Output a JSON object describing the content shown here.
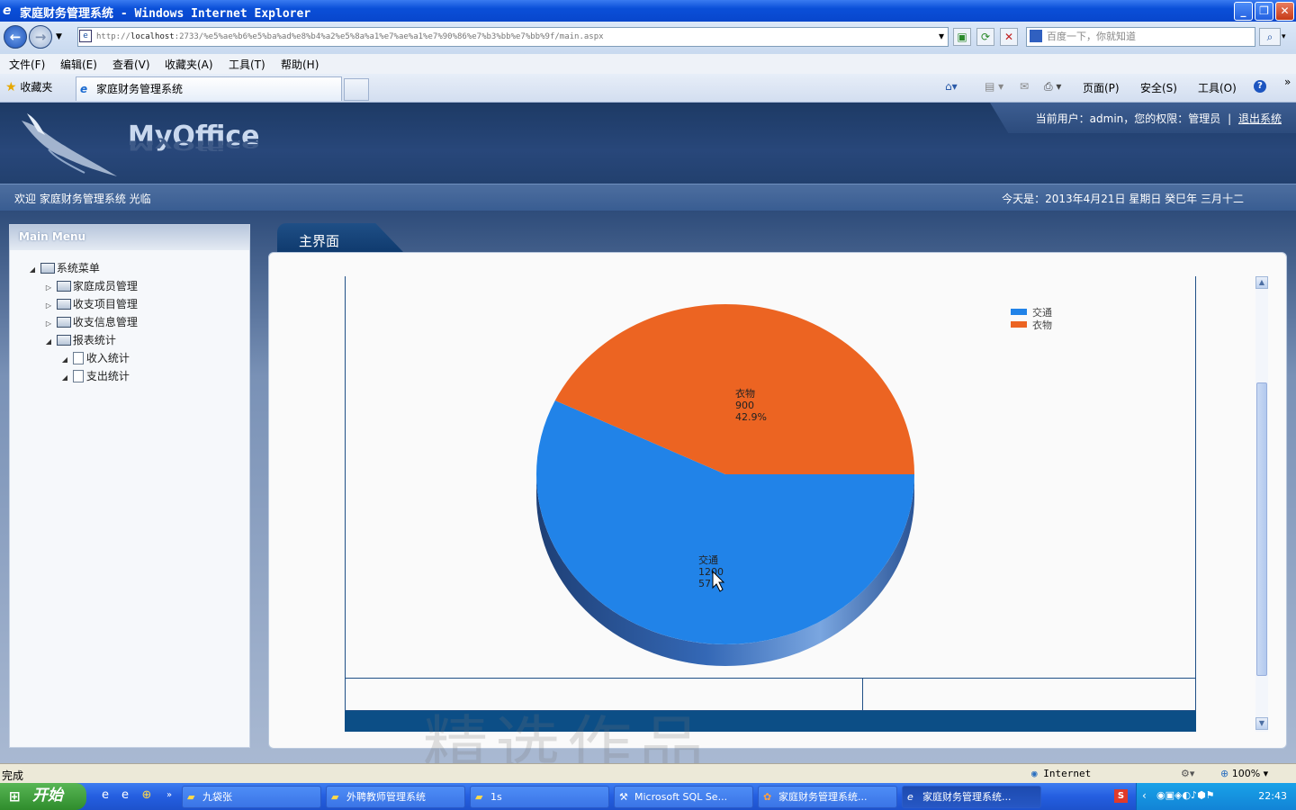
{
  "window": {
    "title": "家庭财务管理系统 - Windows Internet Explorer",
    "buttons": {
      "minimize": "_",
      "restore": "❐",
      "close": "✕"
    }
  },
  "addressbar": {
    "url_prefix": "http://",
    "url_host": "localhost",
    "url_rest": ":2733/%e5%ae%b6%e5%ba%ad%e8%b4%a2%e5%8a%a1%e7%ae%a1%e7%90%86%e7%b3%bb%e7%bb%9f/main.aspx",
    "search_placeholder": "百度一下，你就知道"
  },
  "menubar": [
    "文件(F)",
    "编辑(E)",
    "查看(V)",
    "收藏夹(A)",
    "工具(T)",
    "帮助(H)"
  ],
  "favorites_label": "收藏夹",
  "tab": {
    "title": "家庭财务管理系统"
  },
  "toolbar": {
    "page": "页面(P)",
    "safety": "安全(S)",
    "tools": "工具(O)",
    "help": "?"
  },
  "header": {
    "logo": "MyOffice",
    "user_info": "当前用户：admin，您的权限：管理员",
    "logout": "退出系统",
    "welcome": "欢迎 家庭财务管理系统 光临",
    "today": "今天是：2013年4月21日 星期日 癸巳年 三月十二"
  },
  "sidebar": {
    "title": "Main Menu",
    "tree": [
      {
        "label": "系统菜单",
        "level": 0,
        "toggle": "◢",
        "icon": "folder"
      },
      {
        "label": "家庭成员管理",
        "level": 1,
        "toggle": "▷",
        "icon": "folder"
      },
      {
        "label": "收支项目管理",
        "level": 1,
        "toggle": "▷",
        "icon": "folder"
      },
      {
        "label": "收支信息管理",
        "level": 1,
        "toggle": "▷",
        "icon": "folder"
      },
      {
        "label": "报表统计",
        "level": 1,
        "toggle": "◢",
        "icon": "folder"
      },
      {
        "label": "收入统计",
        "level": 2,
        "toggle": "◢",
        "icon": "page"
      },
      {
        "label": "支出统计",
        "level": 2,
        "toggle": "◢",
        "icon": "page"
      }
    ]
  },
  "main": {
    "tab_label": "主界面",
    "watermark": "精选作品"
  },
  "chart_data": {
    "type": "pie",
    "slices": [
      {
        "name": "交通",
        "value": 1200,
        "percent_label": "57",
        "color": "#2183e8"
      },
      {
        "name": "衣物",
        "value": 900,
        "percent_label": "42.9%",
        "color": "#ec6422"
      }
    ],
    "legend": [
      "交通",
      "衣物"
    ],
    "legend_position": "top-right"
  },
  "statusbar": {
    "status": "完成",
    "zone": "Internet",
    "zoom": "100%"
  },
  "taskbar": {
    "start": "开始",
    "buttons": [
      "九袋张",
      "外聘教师管理系统",
      "1s",
      "Microsoft SQL Se...",
      "家庭财务管理系统...",
      "家庭财务管理系统..."
    ],
    "clock": "22:43"
  }
}
